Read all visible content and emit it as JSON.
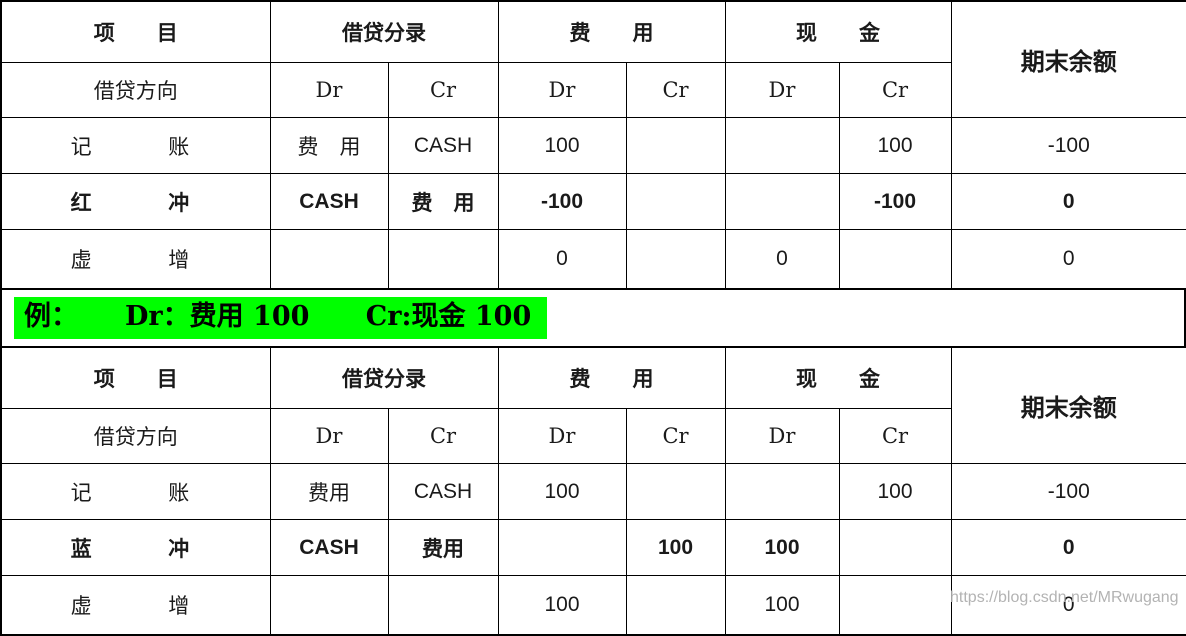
{
  "columns": {
    "item": "项　　目",
    "entry": "借贷分录",
    "expense": "费　　用",
    "cash": "现　　金",
    "ending_balance": "期末余额"
  },
  "subheader": {
    "direction": "借贷方向",
    "entry_dr": "Dr",
    "entry_cr": "Cr",
    "expense_dr": "Dr",
    "expense_cr": "Cr",
    "cash_dr": "Dr",
    "cash_cr": "Cr"
  },
  "colors": {
    "header_bg": "#FBE2D5",
    "gray_row_bg": "#D9D9D9",
    "red_accent": "#FF0000",
    "blue_accent": "#1171BE",
    "green_highlight": "#00FF00"
  },
  "table_red": {
    "rows": [
      {
        "label": "记　　账",
        "entry_dr": "费　用",
        "entry_cr": "CASH",
        "expense_dr": "100",
        "expense_cr": "",
        "cash_dr": "",
        "cash_cr": "100",
        "ending_balance": "-100"
      },
      {
        "label": "红　　冲",
        "entry_dr": "CASH",
        "entry_cr": "费　用",
        "expense_dr": "-100",
        "expense_cr": "",
        "cash_dr": "",
        "cash_cr": "-100",
        "ending_balance": "0"
      },
      {
        "label": "虚　　增",
        "entry_dr": "",
        "entry_cr": "",
        "expense_dr": "0",
        "expense_cr": "",
        "cash_dr": "0",
        "cash_cr": "",
        "ending_balance": "0"
      }
    ]
  },
  "example": {
    "prefix": "例：",
    "debit": "Dr：费用 100",
    "credit": "Cr:现金 100",
    "full": "例：     Dr：费用 100      Cr:现金 100"
  },
  "table_blue": {
    "rows": [
      {
        "label": "记　　账",
        "entry_dr": "费用",
        "entry_cr": "CASH",
        "expense_dr": "100",
        "expense_cr": "",
        "cash_dr": "",
        "cash_cr": "100",
        "ending_balance": "-100"
      },
      {
        "label": "蓝　　冲",
        "entry_dr": "CASH",
        "entry_cr": "费用",
        "expense_dr": "",
        "expense_cr": "100",
        "cash_dr": "100",
        "cash_cr": "",
        "ending_balance": "0"
      },
      {
        "label": "虚　　增",
        "entry_dr": "",
        "entry_cr": "",
        "expense_dr": "100",
        "expense_cr": "",
        "cash_dr": "100",
        "cash_cr": "",
        "ending_balance": "0"
      }
    ]
  },
  "watermark": {
    "text": "https://blog.csdn.net/MRwugang"
  }
}
